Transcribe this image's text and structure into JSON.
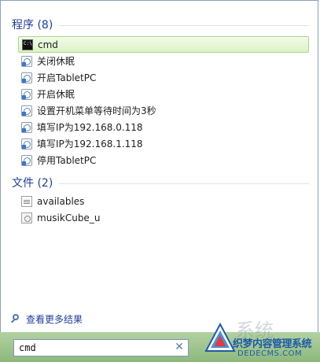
{
  "groups": {
    "programs": {
      "title": "程序 (8)",
      "items": [
        {
          "label": "cmd",
          "icon": "cmd-icon",
          "selected": true
        },
        {
          "label": "关闭休眠",
          "icon": "shortcut-icon"
        },
        {
          "label": "开启TabletPC",
          "icon": "shortcut-icon"
        },
        {
          "label": "开启休眠",
          "icon": "shortcut-icon"
        },
        {
          "label": "设置开机菜单等待时间为3秒",
          "icon": "shortcut-icon"
        },
        {
          "label": "填写IP为192.168.0.118",
          "icon": "shortcut-icon"
        },
        {
          "label": "填写IP为192.168.1.118",
          "icon": "shortcut-icon"
        },
        {
          "label": "停用TabletPC",
          "icon": "shortcut-icon"
        }
      ]
    },
    "files": {
      "title": "文件 (2)",
      "items": [
        {
          "label": "availables",
          "icon": "file-icon"
        },
        {
          "label": "musikCube_u",
          "icon": "gear-file-icon"
        }
      ]
    }
  },
  "see_more": {
    "label": "查看更多结果",
    "icon": "search-icon"
  },
  "search": {
    "value": "cmd",
    "clear_icon": "close-icon"
  },
  "watermark": {
    "line1": "织梦内容管理系统",
    "line2": "DEDECMS.COM",
    "big": "系统"
  },
  "colors": {
    "header_text": "#1f3f9a",
    "selected_bg": "#dcf3c6",
    "bottom_bar": "#9fc48e"
  }
}
